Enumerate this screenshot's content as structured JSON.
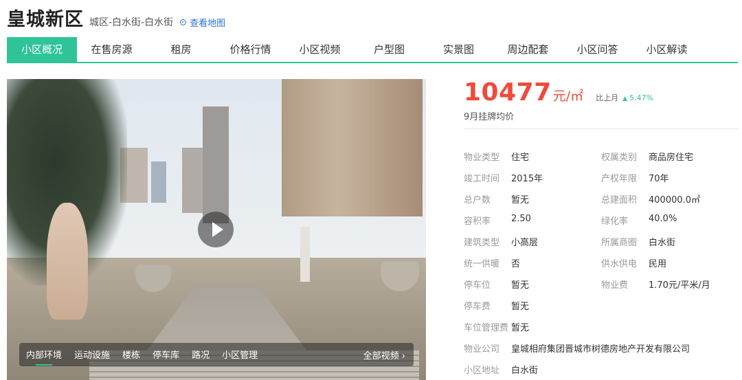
{
  "header": {
    "title": "皇城新区",
    "location": "城区-白水街-白水街",
    "map_link": "查看地图"
  },
  "nav": {
    "tabs": [
      "小区概况",
      "在售房源",
      "租房",
      "价格行情",
      "小区视频",
      "户型图",
      "实景图",
      "周边配套",
      "小区问答",
      "小区解读"
    ],
    "active_index": 0
  },
  "photo": {
    "tabs": [
      "内部环境",
      "运动设施",
      "楼栋",
      "停车库",
      "路况",
      "小区管理"
    ],
    "active_tab": "内部环境",
    "all_video": "全部视频 ›"
  },
  "price": {
    "value": "10477",
    "unit": "元/㎡",
    "compare_label": "比上月",
    "change_pct": "5.47%",
    "trend": "up",
    "description": "9月挂牌均价"
  },
  "info": {
    "rows": [
      [
        {
          "label": "物业类型",
          "value": "住宅"
        },
        {
          "label": "权属类别",
          "value": "商品房住宅"
        }
      ],
      [
        {
          "label": "竣工时间",
          "value": "2015年"
        },
        {
          "label": "产权年限",
          "value": "70年"
        }
      ],
      [
        {
          "label": "总户数",
          "value": "暂无"
        },
        {
          "label": "总建面积",
          "value": "400000.0㎡"
        }
      ],
      [
        {
          "label": "容积率",
          "value": "2.50"
        },
        {
          "label": "绿化率",
          "value": "40.0%"
        }
      ],
      [
        {
          "label": "建筑类型",
          "value": "小高层"
        },
        {
          "label": "所属商圈",
          "value": "白水街"
        }
      ],
      [
        {
          "label": "统一供暖",
          "value": "否"
        },
        {
          "label": "供水供电",
          "value": "民用"
        }
      ],
      [
        {
          "label": "停车位",
          "value": "暂无"
        },
        {
          "label": "物业费",
          "value": "1.70元/平米/月"
        }
      ],
      [
        {
          "label": "停车费",
          "value": "暂无"
        }
      ],
      [
        {
          "label": "车位管理费",
          "value": "暂无"
        }
      ],
      [
        {
          "label": "物业公司",
          "value": "皇城相府集团晋城市树德房地产开发有限公司"
        }
      ],
      [
        {
          "label": "小区地址",
          "value": "白水街"
        }
      ]
    ]
  },
  "colors": {
    "accent": "#2ec498",
    "price": "#f04a3a",
    "link": "#2a6fdb"
  }
}
